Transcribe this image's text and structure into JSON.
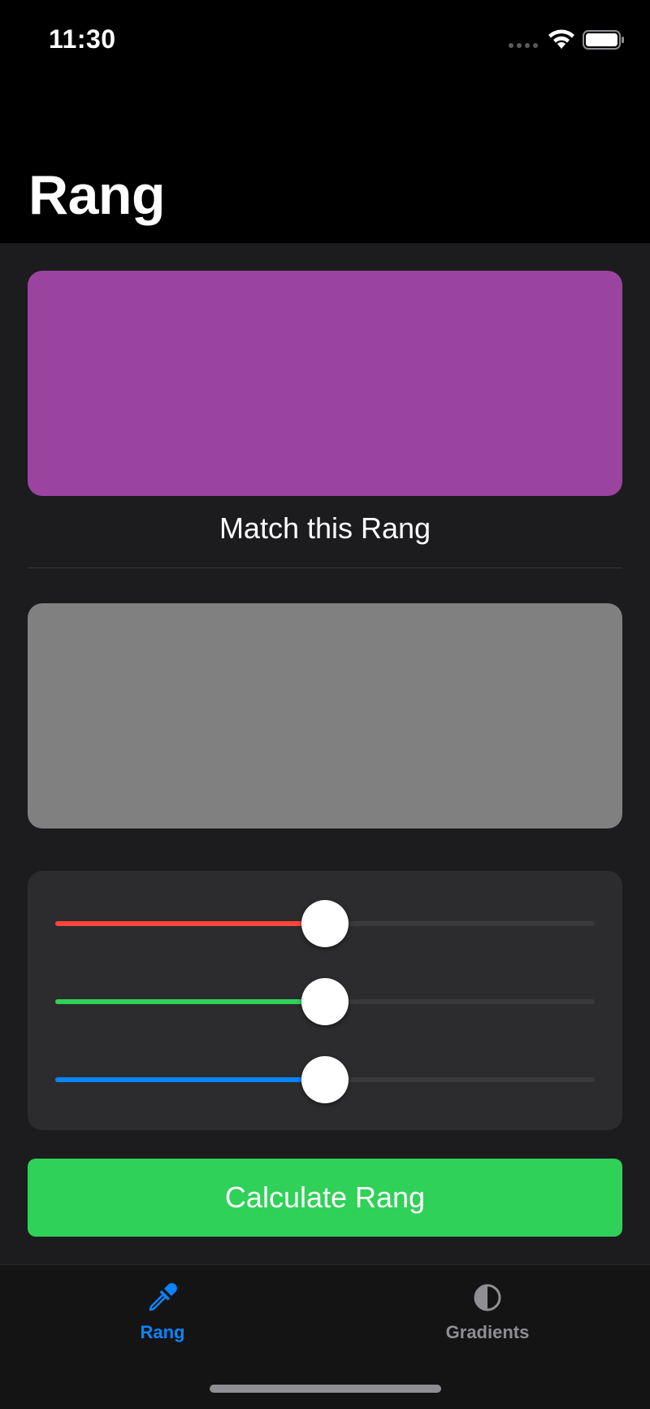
{
  "status_bar": {
    "time": "11:30"
  },
  "header": {
    "title": "Rang"
  },
  "target": {
    "color": "#9a44a0",
    "caption": "Match this Rang"
  },
  "guess": {
    "color": "#808080"
  },
  "sliders": [
    {
      "name": "red",
      "color": "#ff453a",
      "value": 0.5
    },
    {
      "name": "green",
      "color": "#30d158",
      "value": 0.5
    },
    {
      "name": "blue",
      "color": "#0a84ff",
      "value": 0.5
    }
  ],
  "actions": {
    "calculate_label": "Calculate Rang"
  },
  "tab_bar": {
    "items": [
      {
        "label": "Rang",
        "icon": "eyedropper-icon",
        "active": true
      },
      {
        "label": "Gradients",
        "icon": "half-circle-icon",
        "active": false
      }
    ],
    "active_color": "#0a84ff",
    "inactive_color": "#8e8e93"
  }
}
